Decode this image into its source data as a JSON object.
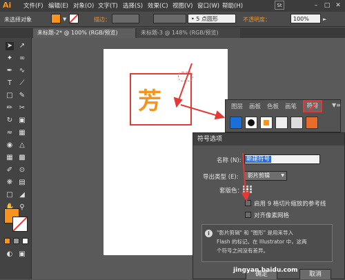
{
  "menubar": {
    "logo": "Ai",
    "items": [
      "文件(F)",
      "编辑(E)",
      "对象(O)",
      "文字(T)",
      "选择(S)",
      "效果(C)",
      "视图(V)",
      "窗口(W)",
      "帮助(H)"
    ],
    "badge": "Br",
    "st_badge": "St"
  },
  "controlbar": {
    "selection_label": "未选择对象",
    "stroke_label": "描边：",
    "brush_value": "5 点圆形",
    "opacity_label": "不透明度：",
    "opacity_value": "100%",
    "style_label": "样式："
  },
  "tabs": [
    {
      "label": "未标题-2* @ 100% (RGB/预览)",
      "active": true
    },
    {
      "label": "未标题-3 @ 148% (RGB/预览)",
      "active": false
    }
  ],
  "artwork": {
    "glyph": "芳",
    "glyph_color": "#f7941d"
  },
  "symbols_panel": {
    "tabs": [
      "图层",
      "画板",
      "色板",
      "画笔",
      "符号"
    ],
    "active_tab": "符号"
  },
  "dialog": {
    "title": "符号选项",
    "name_label": "名称 (N):",
    "name_value": "新建符号",
    "export_type_label": "导出类型 (E):",
    "export_type_value": "影片剪辑",
    "registration_label": "套版色：",
    "checkbox_9slice": "启用 9 格切片缩放的参考线",
    "checkbox_pixel": "对齐像素网格",
    "info_line1": "\"影片剪辑\" 和 \"图形\" 是用来导入",
    "info_line2": "Flash 的标记。在 Illustrator 中，这两",
    "info_line3": "个符号之间没有差异。",
    "ok_label": "确定",
    "cancel_label": "取消"
  },
  "watermark": "jingyan.baidu.com",
  "colors": {
    "accent": "#f7941d",
    "annotation_red": "#e53935",
    "selection_blue": "#2e6cd1"
  }
}
